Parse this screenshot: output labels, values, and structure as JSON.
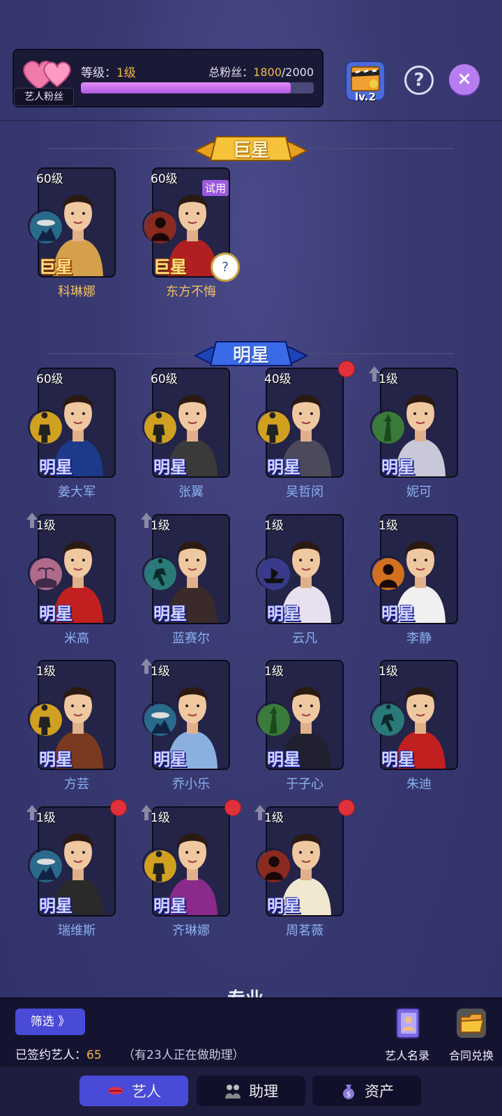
{
  "header": {
    "fans_label": "艺人粉丝",
    "level_prefix": "等级：",
    "level_value": "1级",
    "fans_prefix": "总粉丝：",
    "fans_current": "1800",
    "fans_total": "/2000",
    "fans_progress": 0.9,
    "badge_level": "lv.2",
    "help_label": "?",
    "close_label": "×"
  },
  "sections": {
    "superstar_title": "巨星",
    "star_title": "明星",
    "professional_title": "专业"
  },
  "superstars": [
    {
      "level": "60级",
      "rank": "巨星",
      "name": "科琳娜",
      "genre": "ufo",
      "color": "#d4a04a"
    },
    {
      "level": "60级",
      "rank": "巨星",
      "name": "东方不悔",
      "genre": "silhouette",
      "color": "#b02020",
      "tag": "试用"
    }
  ],
  "stars": [
    {
      "level": "60级",
      "rank": "明星",
      "name": "姜大军",
      "genre": "soldier",
      "color": "#1c3a8a"
    },
    {
      "level": "60级",
      "rank": "明星",
      "name": "张翼",
      "genre": "soldier",
      "color": "#3a3a3a"
    },
    {
      "level": "40级",
      "rank": "明星",
      "name": "吴哲闵",
      "genre": "soldier",
      "color": "#4a4a5a",
      "dot": true
    },
    {
      "level": "1级",
      "rank": "明星",
      "name": "妮可",
      "genre": "statue",
      "color": "#c8c8d8",
      "up": true
    },
    {
      "level": "1级",
      "rank": "明星",
      "name": "米高",
      "genre": "palm",
      "color": "#c02020",
      "up": true
    },
    {
      "level": "1级",
      "rank": "明星",
      "name": "蓝赛尔",
      "genre": "runner",
      "color": "#3a2a2a",
      "up": true
    },
    {
      "level": "1级",
      "rank": "明星",
      "name": "云凡",
      "genre": "ship",
      "color": "#e8e0f0"
    },
    {
      "level": "1级",
      "rank": "明星",
      "name": "李静",
      "genre": "silhouette2",
      "color": "#f0f0f0"
    },
    {
      "level": "1级",
      "rank": "明星",
      "name": "方芸",
      "genre": "soldier",
      "color": "#7a3a20"
    },
    {
      "level": "1级",
      "rank": "明星",
      "name": "乔小乐",
      "genre": "ufo",
      "color": "#8ab0e0",
      "up": true
    },
    {
      "level": "1级",
      "rank": "明星",
      "name": "于子心",
      "genre": "statue",
      "color": "#202030"
    },
    {
      "level": "1级",
      "rank": "明星",
      "name": "朱迪",
      "genre": "runner",
      "color": "#c02020"
    },
    {
      "level": "1级",
      "rank": "明星",
      "name": "瑞维斯",
      "genre": "ufo",
      "color": "#2a2a2a",
      "up": true,
      "dot": true
    },
    {
      "level": "1级",
      "rank": "明星",
      "name": "齐琳娜",
      "genre": "soldier",
      "color": "#8a2a8a",
      "up": true,
      "dot": true
    },
    {
      "level": "1级",
      "rank": "明星",
      "name": "周茗薇",
      "genre": "silhouette",
      "color": "#f0e8d0",
      "up": true,
      "dot": true
    }
  ],
  "footer": {
    "filter_label": "筛选 》",
    "signed_prefix": "已签约艺人：",
    "signed_count": "65",
    "assist_note": "（有23人正在做助理）",
    "roster_label": "艺人名录",
    "contract_label": "合同兑换"
  },
  "tabs": [
    {
      "label": "艺人",
      "active": true
    },
    {
      "label": "助理",
      "active": false
    },
    {
      "label": "资产",
      "active": false
    }
  ],
  "colors": {
    "accent": "#4a4ad8",
    "gold": "#f0b84a",
    "name_blue": "#8ab0f0",
    "name_gold": "#f0c060",
    "progress": "#c070f0"
  }
}
